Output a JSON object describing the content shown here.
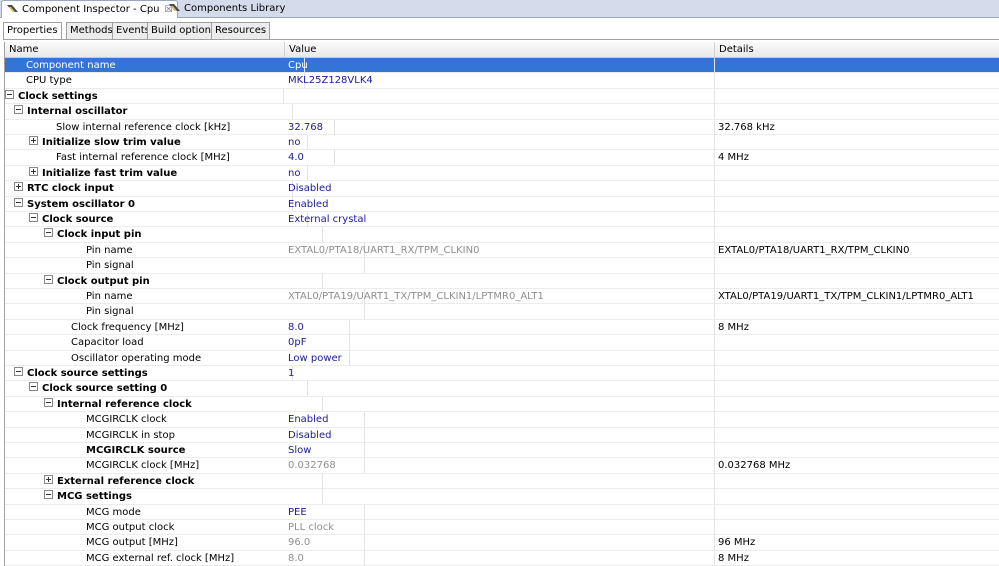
{
  "view_tabs": [
    {
      "label": "Component Inspector - Cpu",
      "close": "☒"
    },
    {
      "label": "Components Library"
    }
  ],
  "sub_tabs": [
    "Properties",
    "Methods",
    "Events",
    "Build options",
    "Resources"
  ],
  "columns": [
    "Name",
    "Value",
    "Details"
  ],
  "rows": [
    {
      "name": "Component name",
      "value": "Cpu",
      "details": "",
      "level": 1,
      "toggle": "",
      "bold": false,
      "gray": false,
      "selected": true
    },
    {
      "name": "CPU type",
      "value": "MKL25Z128VLK4",
      "details": "",
      "level": 1,
      "toggle": "",
      "bold": false,
      "gray": false
    },
    {
      "name": "Clock settings",
      "value": "",
      "details": "",
      "level": 0,
      "toggle": "minus",
      "bold": true
    },
    {
      "name": "Internal oscillator",
      "value": "",
      "details": "",
      "level": 1,
      "toggle": "minus",
      "bold": true
    },
    {
      "name": "Slow internal reference clock [kHz]",
      "value": "32.768",
      "details": "32.768 kHz",
      "level": 3,
      "toggle": ""
    },
    {
      "name": "Initialize slow trim value",
      "value": "no",
      "details": "",
      "level": 2,
      "toggle": "plus",
      "bold": true
    },
    {
      "name": "Fast internal reference clock [MHz]",
      "value": "4.0",
      "details": "4 MHz",
      "level": 3,
      "toggle": ""
    },
    {
      "name": "Initialize fast trim value",
      "value": "no",
      "details": "",
      "level": 2,
      "toggle": "plus",
      "bold": true
    },
    {
      "name": "RTC clock input",
      "value": "Disabled",
      "details": "",
      "level": 1,
      "toggle": "plus",
      "bold": true
    },
    {
      "name": "System oscillator 0",
      "value": "Enabled",
      "details": "",
      "level": 1,
      "toggle": "minus",
      "bold": true
    },
    {
      "name": "Clock source",
      "value": "External crystal",
      "details": "",
      "level": 2,
      "toggle": "minus",
      "bold": true
    },
    {
      "name": "Clock input pin",
      "value": "",
      "details": "",
      "level": 3,
      "toggle": "minus",
      "bold": true
    },
    {
      "name": "Pin name",
      "value": "EXTAL0/PTA18/UART1_RX/TPM_CLKIN0",
      "details": "EXTAL0/PTA18/UART1_RX/TPM_CLKIN0",
      "level": 5,
      "toggle": "",
      "gray": true
    },
    {
      "name": "Pin signal",
      "value": "",
      "details": "",
      "level": 5,
      "toggle": ""
    },
    {
      "name": "Clock output pin",
      "value": "",
      "details": "",
      "level": 3,
      "toggle": "minus",
      "bold": true
    },
    {
      "name": "Pin name",
      "value": "XTAL0/PTA19/UART1_TX/TPM_CLKIN1/LPTMR0_ALT1",
      "details": "XTAL0/PTA19/UART1_TX/TPM_CLKIN1/LPTMR0_ALT1",
      "level": 5,
      "toggle": "",
      "gray": true
    },
    {
      "name": "Pin signal",
      "value": "",
      "details": "",
      "level": 5,
      "toggle": ""
    },
    {
      "name": "Clock frequency [MHz]",
      "value": "8.0",
      "details": "8 MHz",
      "level": 4,
      "toggle": ""
    },
    {
      "name": "Capacitor load",
      "value": "0pF",
      "details": "",
      "level": 4,
      "toggle": ""
    },
    {
      "name": "Oscillator operating mode",
      "value": "Low power",
      "details": "",
      "level": 4,
      "toggle": ""
    },
    {
      "name": "Clock source settings",
      "value": "1",
      "details": "",
      "level": 1,
      "toggle": "minus",
      "bold": true
    },
    {
      "name": "Clock source setting 0",
      "value": "",
      "details": "",
      "level": 2,
      "toggle": "minus",
      "bold": true
    },
    {
      "name": "Internal reference clock",
      "value": "",
      "details": "",
      "level": 3,
      "toggle": "minus",
      "bold": true
    },
    {
      "name": "MCGIRCLK clock",
      "value": "Enabled",
      "details": "",
      "level": 5,
      "toggle": ""
    },
    {
      "name": "MCGIRCLK in stop",
      "value": "Disabled",
      "details": "",
      "level": 5,
      "toggle": ""
    },
    {
      "name": "MCGIRCLK source",
      "value": "Slow",
      "details": "",
      "level": 5,
      "toggle": "",
      "bold": true
    },
    {
      "name": "MCGIRCLK clock [MHz]",
      "value": "0.032768",
      "details": "0.032768 MHz",
      "level": 5,
      "toggle": "",
      "gray": true
    },
    {
      "name": "External reference clock",
      "value": "",
      "details": "",
      "level": 3,
      "toggle": "plus",
      "bold": true
    },
    {
      "name": "MCG settings",
      "value": "",
      "details": "",
      "level": 3,
      "toggle": "minus",
      "bold": true
    },
    {
      "name": "MCG mode",
      "value": "PEE",
      "details": "",
      "level": 5,
      "toggle": ""
    },
    {
      "name": "MCG output clock",
      "value": "PLL clock",
      "details": "",
      "level": 5,
      "toggle": "",
      "gray": true
    },
    {
      "name": "MCG output [MHz]",
      "value": "96.0",
      "details": "96 MHz",
      "level": 5,
      "toggle": "",
      "gray": true
    },
    {
      "name": "MCG external ref. clock [MHz]",
      "value": "8.0",
      "details": "8 MHz",
      "level": 5,
      "toggle": "",
      "gray": true
    }
  ],
  "colors": {
    "selection": "#3375d6",
    "value_text": "#1a1a99",
    "disabled_text": "#8f8f8f",
    "tab_bar": "#d4dcec"
  }
}
